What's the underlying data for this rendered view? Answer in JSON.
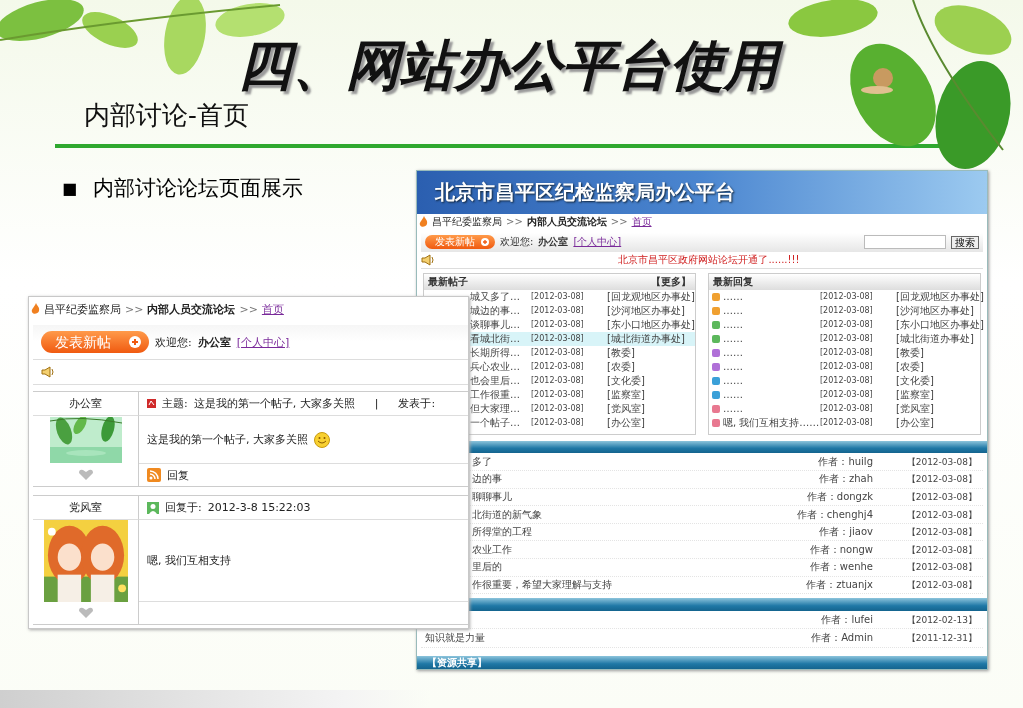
{
  "slide": {
    "title": "四、网站办公平台使用",
    "subtitle": "内部讨论-首页",
    "bullet_marker": "■",
    "bullet": "内部讨论论坛页面展示"
  },
  "platform_screenshot": {
    "banner_title": "北京市昌平区纪检监察局办公平台",
    "breadcrumb": [
      {
        "label": "昌平纪委监察局",
        "kind": "plain"
      },
      {
        "label": ">>",
        "kind": "separator"
      },
      {
        "label": "内部人员交流论坛",
        "kind": "bold"
      },
      {
        "label": ">>",
        "kind": "separator"
      },
      {
        "label": "首页",
        "kind": "link"
      }
    ],
    "toolbar": {
      "new_post_button": "发表新帖",
      "welcome": "欢迎您:",
      "user": "办公室",
      "profile_link": "[个人中心]",
      "search_button": "搜索"
    },
    "notice": "北京市昌平区政府网站论坛开通了......!!!",
    "latest_posts": {
      "title": "最新帖子",
      "more": "【更多】",
      "rows": [
        {
          "title": "城又多了…",
          "date": "[2012-03-08]",
          "dept": "[回龙观地区办事处]",
          "selected": false
        },
        {
          "title": "城边的事…",
          "date": "[2012-03-08]",
          "dept": "[沙河地区办事处]",
          "selected": false
        },
        {
          "title": "谈聊事儿…",
          "date": "[2012-03-08]",
          "dept": "[东小口地区办事处]",
          "selected": false
        },
        {
          "title": "看城北街…",
          "date": "[2012-03-08]",
          "dept": "[城北街道办事处]",
          "selected": true
        },
        {
          "title": "长期所得…",
          "date": "[2012-03-08]",
          "dept": "[教委]",
          "selected": false
        },
        {
          "title": "兵心农业…",
          "date": "[2012-03-08]",
          "dept": "[农委]",
          "selected": false
        },
        {
          "title": "也会里后…",
          "date": "[2012-03-08]",
          "dept": "[文化委]",
          "selected": false
        },
        {
          "title": "工作很重…",
          "date": "[2012-03-08]",
          "dept": "[监察室]",
          "selected": false
        },
        {
          "title": "但大家理…",
          "date": "[2012-03-08]",
          "dept": "[党风室]",
          "selected": false
        },
        {
          "title": "一个帖子…",
          "date": "[2012-03-08]",
          "dept": "[办公室]",
          "selected": false
        }
      ]
    },
    "latest_replies": {
      "title": "最新回复",
      "rows": [
        {
          "color": "#f0a030",
          "title": "……",
          "date": "[2012-03-08]",
          "dept": "[回龙观地区办事处]"
        },
        {
          "color": "#f0a030",
          "title": "……",
          "date": "[2012-03-08]",
          "dept": "[沙河地区办事处]"
        },
        {
          "color": "#5cb85c",
          "title": "……",
          "date": "[2012-03-08]",
          "dept": "[东小口地区办事处]"
        },
        {
          "color": "#5cb85c",
          "title": "……",
          "date": "[2012-03-08]",
          "dept": "[城北街道办事处]"
        },
        {
          "color": "#b070d8",
          "title": "……",
          "date": "[2012-03-08]",
          "dept": "[教委]"
        },
        {
          "color": "#b070d8",
          "title": "……",
          "date": "[2012-03-08]",
          "dept": "[农委]"
        },
        {
          "color": "#3aa0d8",
          "title": "……",
          "date": "[2012-03-08]",
          "dept": "[文化委]"
        },
        {
          "color": "#3aa0d8",
          "title": "……",
          "date": "[2012-03-08]",
          "dept": "[监察室]"
        },
        {
          "color": "#e87890",
          "title": "……",
          "date": "[2012-03-08]",
          "dept": "[党风室]"
        },
        {
          "color": "#e87890",
          "title": "嗯, 我们互相支持……",
          "date": "[2012-03-08]",
          "dept": "[办公室]"
        }
      ]
    },
    "sections": [
      {
        "rows": [
          {
            "title": "多了",
            "author": "作者：huilg",
            "date": "【2012-03-08】"
          },
          {
            "title": "边的事",
            "author": "作者：zhah",
            "date": "【2012-03-08】"
          },
          {
            "title": "聊聊事儿",
            "author": "作者：dongzk",
            "date": "【2012-03-08】"
          },
          {
            "title": "北街道的新气象",
            "author": "作者：chenghj4",
            "date": "【2012-03-08】"
          },
          {
            "title": "所得堂的工程",
            "author": "作者：jiaov",
            "date": "【2012-03-08】"
          },
          {
            "title": "农业工作",
            "author": "作者：nongw",
            "date": "【2012-03-08】"
          },
          {
            "title": "里后的",
            "author": "作者：wenhe",
            "date": "【2012-03-08】"
          },
          {
            "title": "作很重要，希望大家理解与支持",
            "author": "作者：ztuanjx",
            "date": "【2012-03-08】"
          }
        ]
      },
      {
        "rows": [
          {
            "author": "作者：lufei",
            "date": "【2012-02-13】"
          },
          {
            "title": "知识就是力量",
            "author": "作者：Admin",
            "date": "【2011-12-31】"
          }
        ]
      },
      {
        "title": "【资源共享】"
      }
    ]
  },
  "forum_screenshot": {
    "breadcrumb": [
      {
        "label": "昌平纪委监察局",
        "kind": "plain"
      },
      {
        "label": ">>",
        "kind": "separator"
      },
      {
        "label": "内部人员交流论坛",
        "kind": "bold"
      },
      {
        "label": ">>",
        "kind": "separator"
      },
      {
        "label": "首页",
        "kind": "link"
      }
    ],
    "toolbar": {
      "new_post_button": "发表新帖",
      "welcome": "欢迎您:",
      "user": "办公室",
      "profile_link": "[个人中心]"
    },
    "posts": [
      {
        "kind": "topic",
        "author": "办公室",
        "header_label": "主题:",
        "header_text": "这是我的第一个帖子, 大家多关照",
        "divider": "|",
        "posted_label": "发表于:",
        "body": "这是我的第一个帖子, 大家多关照",
        "reply": "回复"
      },
      {
        "kind": "reply",
        "author": "党风室",
        "header_label": "回复于:",
        "header_text": "2012-3-8 15:22:03",
        "body": "嗯, 我们互相支持"
      }
    ]
  }
}
